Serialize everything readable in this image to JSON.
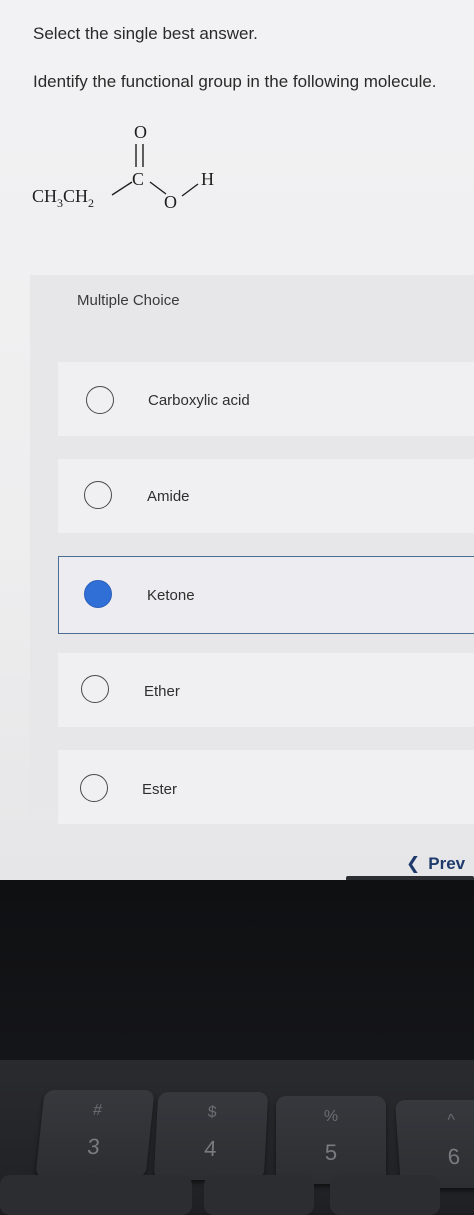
{
  "instruction": "Select the single best answer.",
  "question": "Identify the functional group in the following molecule.",
  "molecule": {
    "oxygen_top": "O",
    "carbon": "C",
    "oxygen": "O",
    "hydrogen": "H",
    "ethyl_prefix": "CH",
    "sub1": "3",
    "ethyl_mid": "CH",
    "sub2": "2"
  },
  "multiple_choice_label": "Multiple Choice",
  "options": [
    {
      "label": "Carboxylic acid",
      "selected": false
    },
    {
      "label": "Amide",
      "selected": false
    },
    {
      "label": "Ketone",
      "selected": true
    },
    {
      "label": "Ether",
      "selected": false
    },
    {
      "label": "Ester",
      "selected": false
    }
  ],
  "nav": {
    "prev_label": "Prev",
    "prev_icon": "chevron-left-icon"
  },
  "keyboard": [
    {
      "symbol": "#",
      "number": "3"
    },
    {
      "symbol": "$",
      "number": "4"
    },
    {
      "symbol": "%",
      "number": "5"
    },
    {
      "symbol": "^",
      "number": "6"
    }
  ],
  "colors": {
    "selected_radio": "#2f6fd6",
    "prev_text": "#1d3a6b"
  }
}
